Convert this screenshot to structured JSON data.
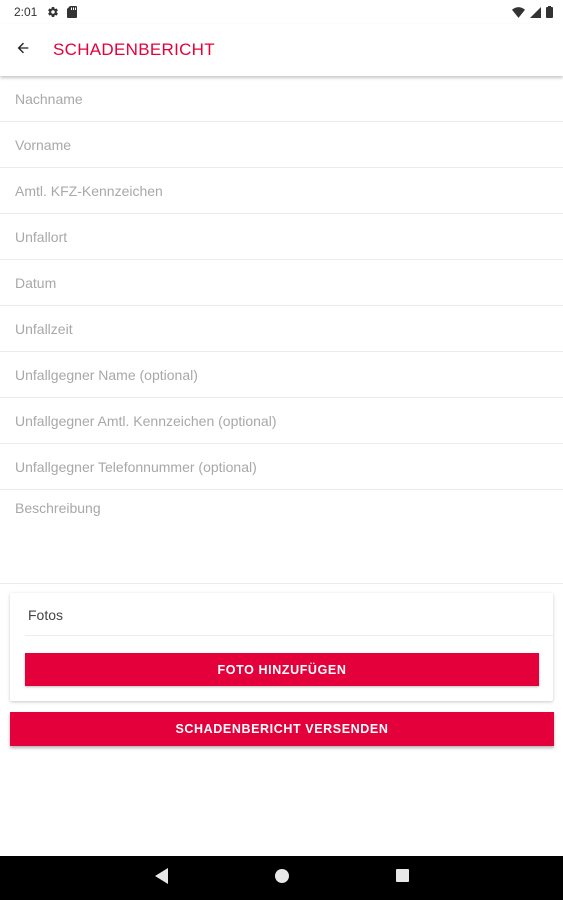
{
  "status_bar": {
    "time": "2:01",
    "left_icons": [
      "gear-icon",
      "sd-card-icon"
    ],
    "right_icons": [
      "wifi-icon",
      "signal-icon",
      "battery-icon"
    ]
  },
  "app_bar": {
    "back_icon": "arrow-left-icon",
    "title": "SCHADENBERICHT"
  },
  "form": {
    "fields": [
      {
        "placeholder": "Nachname",
        "value": ""
      },
      {
        "placeholder": "Vorname",
        "value": ""
      },
      {
        "placeholder": "Amtl. KFZ-Kennzeichen",
        "value": ""
      },
      {
        "placeholder": "Unfallort",
        "value": ""
      },
      {
        "placeholder": "Datum",
        "value": ""
      },
      {
        "placeholder": "Unfallzeit",
        "value": ""
      },
      {
        "placeholder": "Unfallgegner Name (optional)",
        "value": ""
      },
      {
        "placeholder": "Unfallgegner Amtl. Kennzeichen (optional)",
        "value": ""
      },
      {
        "placeholder": "Unfallgegner Telefonnummer (optional)",
        "value": ""
      }
    ],
    "description": {
      "placeholder": "Beschreibung",
      "value": ""
    }
  },
  "photos": {
    "title": "Fotos",
    "add_button_label": "FOTO HINZUFÜGEN"
  },
  "send_button_label": "SCHADENBERICHT VERSENDEN",
  "nav_bar": {
    "icons": [
      "back-triangle-icon",
      "home-circle-icon",
      "recents-square-icon"
    ]
  },
  "colors": {
    "accent": "#e4003a",
    "placeholder": "#a8a8a8",
    "divider": "#ececec",
    "nav_background": "#000000"
  }
}
